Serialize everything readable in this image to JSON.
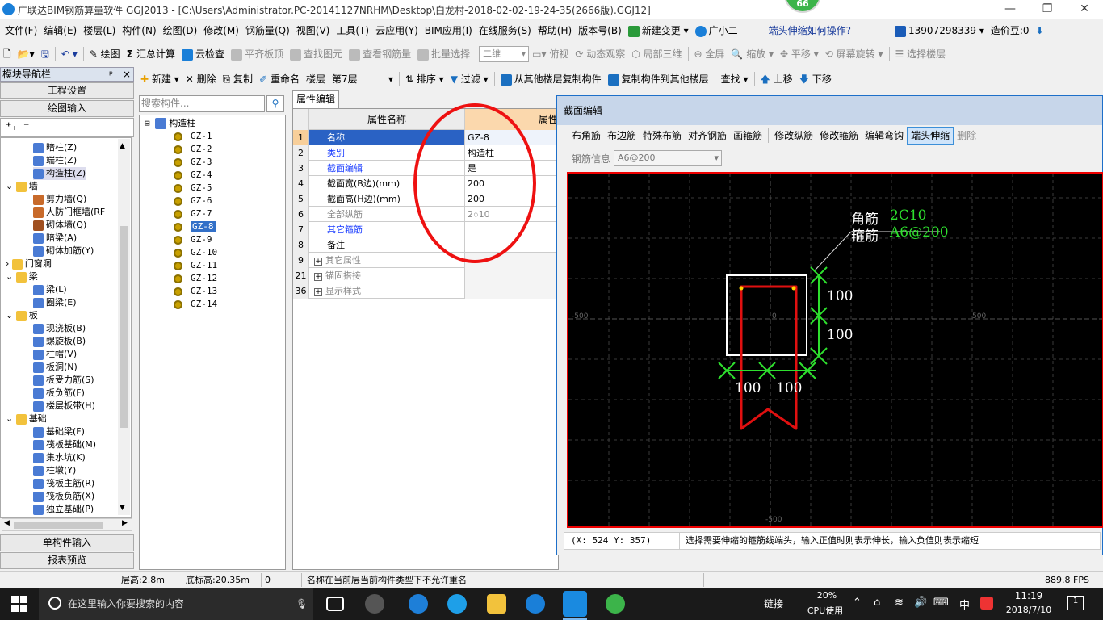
{
  "window": {
    "title": "广联达BIM钢筋算量软件 GGJ2013 - [C:\\Users\\Administrator.PC-20141127NRHM\\Desktop\\白龙村-2018-02-02-19-24-35(2666版).GGJ12]",
    "badge": "66",
    "minimize": "—",
    "restore": "❐",
    "close": "✕"
  },
  "menubar": {
    "items": [
      "文件(F)",
      "编辑(E)",
      "楼层(L)",
      "构件(N)",
      "绘图(D)",
      "修改(M)",
      "钢筋量(Q)",
      "视图(V)",
      "工具(T)",
      "云应用(Y)",
      "BIM应用(I)",
      "在线服务(S)",
      "帮助(H)",
      "版本号(B)",
      "新建变更",
      "广小二"
    ],
    "help_link": "端头伸缩如何操作?",
    "phone": "13907298339",
    "beans": "造价豆:0"
  },
  "toolbar1": {
    "draw": "绘图",
    "sum": "汇总计算",
    "cloud_check": "云检查",
    "align_top": "平齐板顶",
    "find_element": "查找图元",
    "view_rebar": "查看钢筋量",
    "batch_select": "批量选择",
    "view_mode": "二维",
    "top_view": "俯视",
    "dynamic": "动态观察",
    "local3d": "局部三维",
    "fullscreen": "全屏",
    "zoom": "缩放",
    "pan": "平移",
    "rotate": "屏幕旋转",
    "select_floor": "选择楼层"
  },
  "toolbar2": {
    "new": "新建",
    "delete": "删除",
    "copy": "复制",
    "rename": "重命名",
    "floor_label": "楼层",
    "floor_value": "第7层",
    "sort": "排序",
    "filter": "过滤",
    "copy_from": "从其他楼层复制构件",
    "copy_to": "复制构件到其他楼层",
    "find": "查找",
    "up": "上移",
    "down": "下移"
  },
  "nav": {
    "header": "模块导航栏",
    "pin": "ᵖ",
    "close": "×",
    "project_settings": "工程设置",
    "drawing_input": "绘图输入",
    "tree": [
      {
        "label": "暗柱(Z)",
        "level": 2,
        "folder": false,
        "color": "#4a7bd4"
      },
      {
        "label": "端柱(Z)",
        "level": 2,
        "folder": false,
        "color": "#4a7bd4"
      },
      {
        "label": "构造柱(Z)",
        "level": 2,
        "folder": false,
        "color": "#4a7bd4",
        "selected": true
      },
      {
        "label": "墙",
        "level": 1,
        "folder": true
      },
      {
        "label": "剪力墙(Q)",
        "level": 2,
        "folder": false,
        "color": "#c86a2a"
      },
      {
        "label": "人防门框墙(RF",
        "level": 2,
        "folder": false,
        "color": "#c86a2a"
      },
      {
        "label": "砌体墙(Q)",
        "level": 2,
        "folder": false,
        "color": "#a05020"
      },
      {
        "label": "暗梁(A)",
        "level": 2,
        "folder": false,
        "color": "#4a7bd4"
      },
      {
        "label": "砌体加筋(Y)",
        "level": 2,
        "folder": false,
        "color": "#4a7bd4"
      },
      {
        "label": "门窗洞",
        "level": 1,
        "folder": true,
        "collapsed": true
      },
      {
        "label": "梁",
        "level": 1,
        "folder": true
      },
      {
        "label": "梁(L)",
        "level": 2,
        "folder": false,
        "color": "#4a7bd4"
      },
      {
        "label": "圈梁(E)",
        "level": 2,
        "folder": false,
        "color": "#4a7bd4"
      },
      {
        "label": "板",
        "level": 1,
        "folder": true
      },
      {
        "label": "现浇板(B)",
        "level": 2,
        "folder": false,
        "color": "#4a7bd4"
      },
      {
        "label": "螺旋板(B)",
        "level": 2,
        "folder": false,
        "color": "#4a7bd4"
      },
      {
        "label": "柱帽(V)",
        "level": 2,
        "folder": false,
        "color": "#4a7bd4"
      },
      {
        "label": "板洞(N)",
        "level": 2,
        "folder": false,
        "color": "#4a7bd4"
      },
      {
        "label": "板受力筋(S)",
        "level": 2,
        "folder": false,
        "color": "#4a7bd4"
      },
      {
        "label": "板负筋(F)",
        "level": 2,
        "folder": false,
        "color": "#4a7bd4"
      },
      {
        "label": "楼层板带(H)",
        "level": 2,
        "folder": false,
        "color": "#4a7bd4"
      },
      {
        "label": "基础",
        "level": 1,
        "folder": true
      },
      {
        "label": "基础梁(F)",
        "level": 2,
        "folder": false,
        "color": "#4a7bd4"
      },
      {
        "label": "筏板基础(M)",
        "level": 2,
        "folder": false,
        "color": "#4a7bd4"
      },
      {
        "label": "集水坑(K)",
        "level": 2,
        "folder": false,
        "color": "#4a7bd4"
      },
      {
        "label": "柱墩(Y)",
        "level": 2,
        "folder": false,
        "color": "#4a7bd4"
      },
      {
        "label": "筏板主筋(R)",
        "level": 2,
        "folder": false,
        "color": "#4a7bd4"
      },
      {
        "label": "筏板负筋(X)",
        "level": 2,
        "folder": false,
        "color": "#4a7bd4"
      },
      {
        "label": "独立基础(P)",
        "level": 2,
        "folder": false,
        "color": "#4a7bd4"
      }
    ],
    "single_input": "单构件输入",
    "report_preview": "报表预览"
  },
  "components": {
    "search_placeholder": "搜索构件...",
    "root": "构造柱",
    "items": [
      "GZ-1",
      "GZ-2",
      "GZ-3",
      "GZ-4",
      "GZ-5",
      "GZ-6",
      "GZ-7",
      "GZ-8",
      "GZ-9",
      "GZ-10",
      "GZ-11",
      "GZ-12",
      "GZ-13",
      "GZ-14"
    ],
    "selected": "GZ-8"
  },
  "properties": {
    "tab": "属性编辑",
    "col_name": "属性名称",
    "col_value": "属性",
    "rows": [
      {
        "num": "1",
        "name": "名称",
        "value": "GZ-8",
        "style": "blue"
      },
      {
        "num": "2",
        "name": "类别",
        "value": "构造柱",
        "style": "blue"
      },
      {
        "num": "3",
        "name": "截面编辑",
        "value": "是",
        "style": "blue"
      },
      {
        "num": "4",
        "name": "截面宽(B边)(mm)",
        "value": "200",
        "style": ""
      },
      {
        "num": "5",
        "name": "截面高(H边)(mm)",
        "value": "200",
        "style": ""
      },
      {
        "num": "6",
        "name": "全部纵筋",
        "value": "2⌽10",
        "style": "gray"
      },
      {
        "num": "7",
        "name": "其它箍筋",
        "value": "",
        "style": "blue"
      },
      {
        "num": "8",
        "name": "备注",
        "value": "",
        "style": ""
      },
      {
        "num": "9",
        "name": "其它属性",
        "value": "",
        "style": "gray",
        "expand": true
      },
      {
        "num": "21",
        "name": "锚固搭接",
        "value": "",
        "style": "gray",
        "expand": true
      },
      {
        "num": "36",
        "name": "显示样式",
        "value": "",
        "style": "gray",
        "expand": true
      }
    ]
  },
  "section_editor": {
    "title": "截面编辑",
    "tools": [
      "布角筋",
      "布边筋",
      "特殊布筋",
      "对齐钢筋",
      "画箍筋",
      "修改纵筋",
      "修改箍筋",
      "编辑弯钩",
      "端头伸缩",
      "删除"
    ],
    "active_tool": "端头伸缩",
    "rebar_info_label": "钢筋信息",
    "rebar_info_value": "A6@200",
    "canvas": {
      "corner_label": "角筋",
      "corner_value": "2C10",
      "stirrup_label": "箍筋",
      "stirrup_value": "A6@200",
      "dim_v1": "100",
      "dim_v2": "100",
      "dim_h1": "100",
      "dim_h2": "100",
      "axis_left": "-500",
      "axis_center": "0",
      "axis_right": "500",
      "axis_bottom": "-500"
    },
    "coords": "(X: 524 Y: 357)",
    "hint": "选择需要伸缩的箍筋线端头，输入正值时则表示伸长，输入负值则表示缩短"
  },
  "statusbar": {
    "floor_height": "层高:2.8m",
    "base_height": "底标高:20.35m",
    "zero": "0",
    "message": "名称在当前层当前构件类型下不允许重名",
    "fps": "889.8 FPS"
  },
  "taskbar": {
    "search_placeholder": "在这里输入你要搜索的内容",
    "link": "链接",
    "cpu_percent": "20%",
    "cpu_label": "CPU使用",
    "ime": "中",
    "time": "11:19",
    "date": "2018/7/10",
    "notif": "1"
  }
}
